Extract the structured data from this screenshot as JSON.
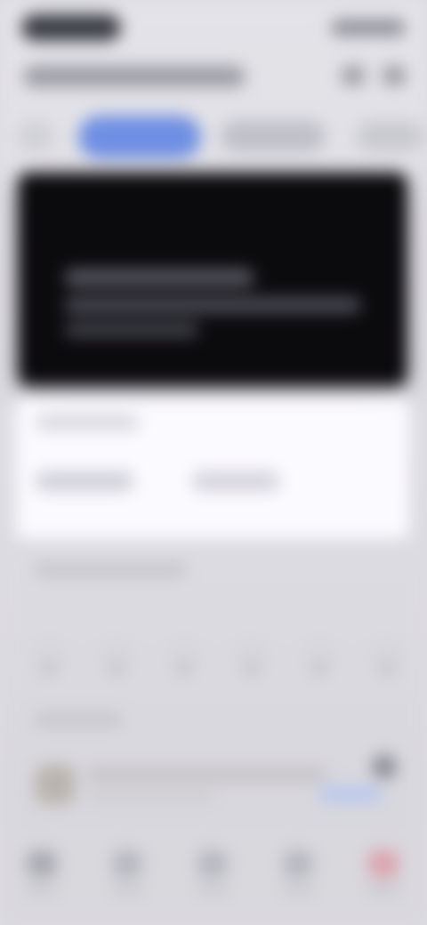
{
  "status_bar": {
    "time": "",
    "right_status": ""
  },
  "header": {
    "title": "",
    "icon_1": "search-icon",
    "icon_2": "more-icon"
  },
  "tabs": [
    {
      "label": ""
    },
    {
      "label": ""
    },
    {
      "label": ""
    },
    {
      "label": ""
    }
  ],
  "hero": {
    "title": "",
    "subtitle_1": "",
    "subtitle_2": ""
  },
  "summary_card": {
    "label": "",
    "value_a": "",
    "value_b": ""
  },
  "section": {
    "title": ""
  },
  "quick_actions": [
    {
      "label": ""
    },
    {
      "label": ""
    },
    {
      "label": ""
    },
    {
      "label": ""
    },
    {
      "label": ""
    },
    {
      "label": ""
    }
  ],
  "lower_section": {
    "title": ""
  },
  "promo": {
    "title": "",
    "subtitle": "",
    "chip": ""
  },
  "bottom_nav": [
    {
      "label": "",
      "icon": "home-icon"
    },
    {
      "label": "",
      "icon": "discover-icon"
    },
    {
      "label": "",
      "icon": "center-icon"
    },
    {
      "label": "",
      "icon": "message-icon"
    },
    {
      "label": "",
      "icon": "profile-icon"
    }
  ],
  "colors": {
    "accent": "#6f8fe4",
    "hero_background": "#0b0a0d",
    "card_background": "#fbfafe"
  }
}
